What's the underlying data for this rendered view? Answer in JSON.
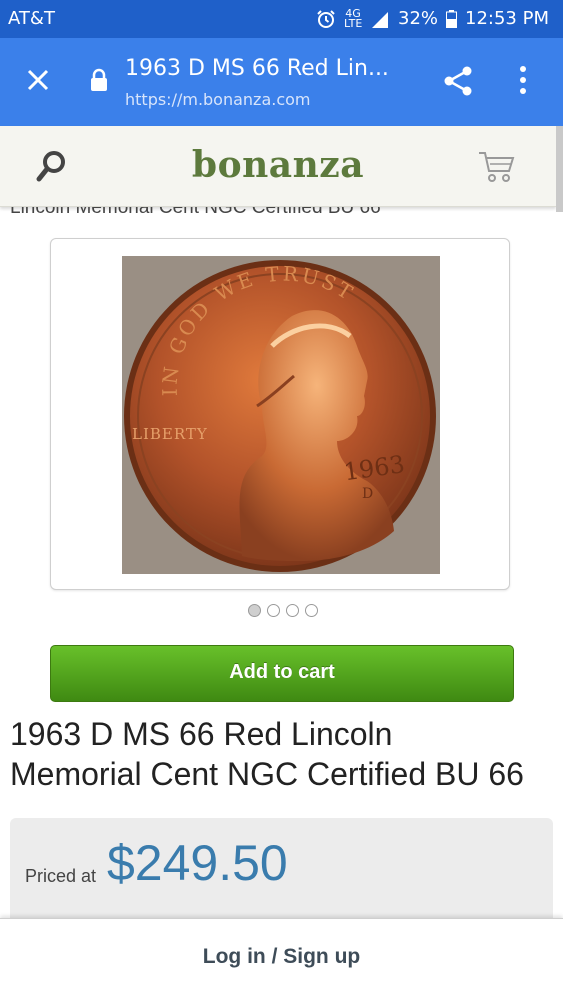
{
  "status_bar": {
    "carrier": "AT&T",
    "network": "4G LTE",
    "battery": "32%",
    "time": "12:53 PM"
  },
  "browser": {
    "page_title": "1963 D MS 66 Red Lin...",
    "url": "https://m.bonanza.com",
    "icons": [
      "close-icon",
      "lock-icon",
      "share-icon",
      "more-vert-icon"
    ]
  },
  "site_header": {
    "logo": "bonanza",
    "icons": [
      "search-icon",
      "cart-icon"
    ],
    "logo_color": "#5d7a3d"
  },
  "product": {
    "ghost_title": "Lincoln Memorial Cent NGC Certified BU 66",
    "image_caption": {
      "motto": "IN GOD WE TRUST",
      "liberty": "LIBERTY",
      "year": "1963",
      "mint_mark": "D"
    },
    "carousel": {
      "count": 4,
      "active_index": 0
    },
    "add_to_cart_label": "Add to cart",
    "title_line1": "1963 D MS 66 Red Lincoln",
    "title_line2": "Memorial Cent NGC Certified BU 66",
    "priced_at_label": "Priced at",
    "price": "$249.50",
    "price_color": "#3a7cad"
  },
  "footer": {
    "login_label": "Log in / Sign up"
  }
}
